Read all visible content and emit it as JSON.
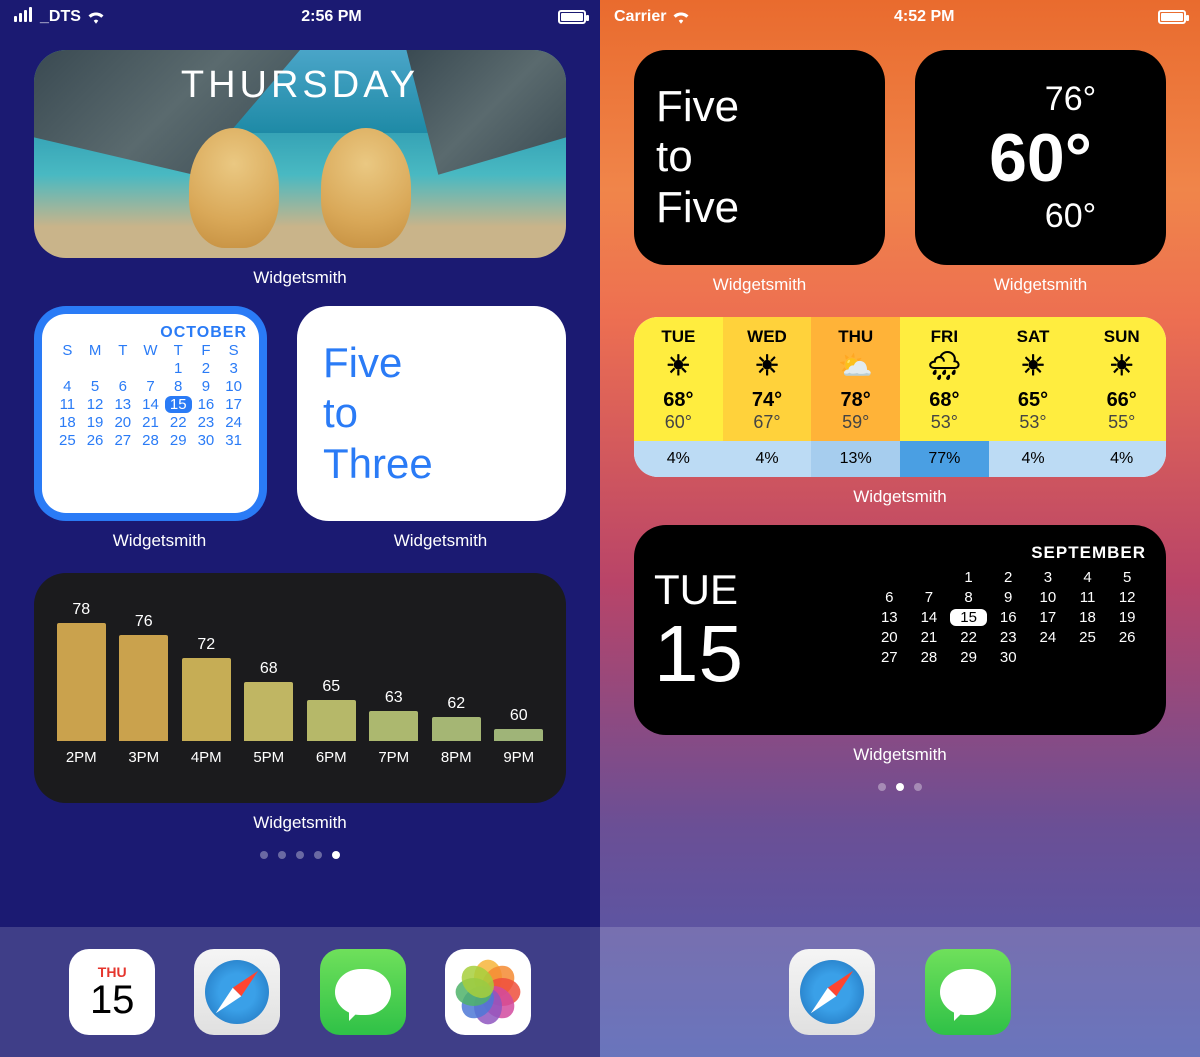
{
  "left": {
    "status": {
      "carrier": "_DTS",
      "time": "2:56 PM"
    },
    "photo": {
      "day": "THURSDAY",
      "label": "Widgetsmith"
    },
    "calendar": {
      "month": "OCTOBER",
      "dow": [
        "S",
        "M",
        "T",
        "W",
        "T",
        "F",
        "S"
      ],
      "start_pad": 4,
      "days": 31,
      "today": 15,
      "label": "Widgetsmith"
    },
    "timewords": {
      "line1": "Five",
      "line2": "to",
      "line3": "Three",
      "label": "Widgetsmith"
    },
    "chart": {
      "label": "Widgetsmith"
    },
    "page_dots": {
      "count": 5,
      "active": 4
    },
    "dock": {
      "cal": {
        "dow": "THU",
        "day": "15"
      }
    }
  },
  "right": {
    "status": {
      "carrier": "Carrier",
      "time": "4:52 PM"
    },
    "timewords": {
      "line1": "Five",
      "line2": "to",
      "line3": "Five",
      "label": "Widgetsmith"
    },
    "temp": {
      "hi": "76°",
      "cur": "60°",
      "lo": "60°",
      "label": "Widgetsmith"
    },
    "forecast": {
      "label": "Widgetsmith",
      "days": [
        {
          "d": "TUE",
          "icon": "☀",
          "hi": "68°",
          "lo": "60°",
          "precip": "4%",
          "bg": "#ffed3f",
          "pbg": "#bcdbf4"
        },
        {
          "d": "WED",
          "icon": "☀",
          "hi": "74°",
          "lo": "67°",
          "precip": "4%",
          "bg": "#ffd23b",
          "pbg": "#bcdbf4"
        },
        {
          "d": "THU",
          "icon": "⛅",
          "hi": "78°",
          "lo": "59°",
          "precip": "13%",
          "bg": "#ffb338",
          "pbg": "#a6cdee"
        },
        {
          "d": "FRI",
          "icon": "🌧",
          "hi": "68°",
          "lo": "53°",
          "precip": "77%",
          "bg": "#ffed3f",
          "pbg": "#4a9fe3"
        },
        {
          "d": "SAT",
          "icon": "☀",
          "hi": "65°",
          "lo": "53°",
          "precip": "4%",
          "bg": "#ffed3f",
          "pbg": "#bcdbf4"
        },
        {
          "d": "SUN",
          "icon": "☀",
          "hi": "66°",
          "lo": "55°",
          "precip": "4%",
          "bg": "#ffed3f",
          "pbg": "#bcdbf4"
        }
      ]
    },
    "daycal": {
      "dow": "TUE",
      "day": "15",
      "month": "SEPTEMBER",
      "start_pad": 2,
      "days": 30,
      "today": 15,
      "label": "Widgetsmith"
    },
    "page_dots": {
      "count": 3,
      "active": 1
    }
  },
  "chart_data": {
    "type": "bar",
    "categories": [
      "2PM",
      "3PM",
      "4PM",
      "5PM",
      "6PM",
      "7PM",
      "8PM",
      "9PM"
    ],
    "values": [
      78,
      76,
      72,
      68,
      65,
      63,
      62,
      60
    ],
    "colors": [
      "#caa24d",
      "#caa24d",
      "#c6ad55",
      "#c0b663",
      "#b6b869",
      "#acb86f",
      "#a5b674",
      "#9fb478"
    ],
    "title": "",
    "xlabel": "",
    "ylabel": "",
    "ylim": [
      58,
      80
    ]
  }
}
